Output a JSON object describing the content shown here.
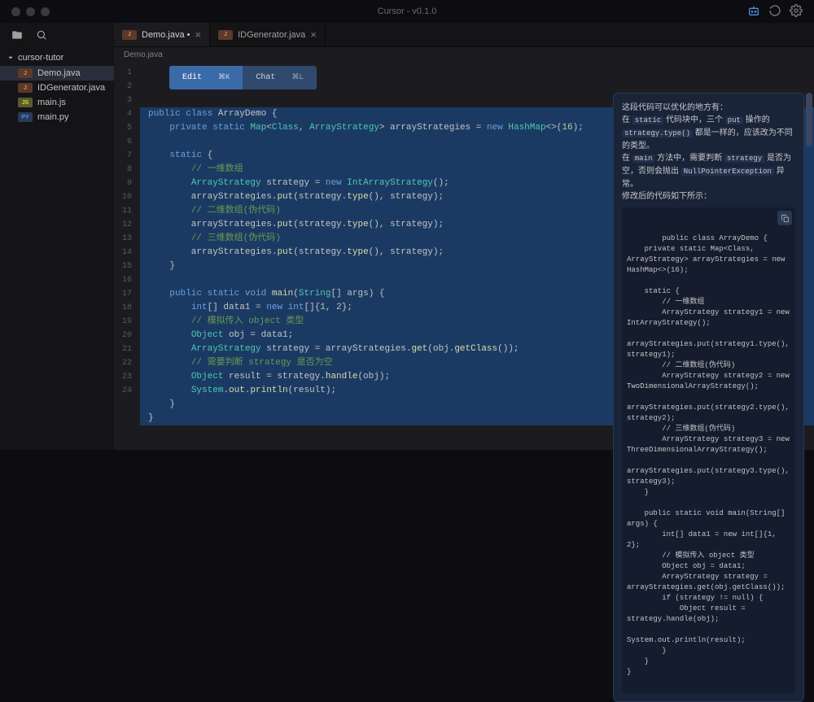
{
  "window": {
    "title": "Cursor - v0.1.0"
  },
  "sidebar": {
    "folder": "cursor-tutor",
    "files": [
      {
        "icon": "J",
        "cls": "ico-j",
        "name": "Demo.java",
        "active": true
      },
      {
        "icon": "J",
        "cls": "ico-j",
        "name": "IDGenerator.java",
        "active": false
      },
      {
        "icon": "JS",
        "cls": "ico-js",
        "name": "main.js",
        "active": false
      },
      {
        "icon": "PY",
        "cls": "ico-py",
        "name": "main.py",
        "active": false
      }
    ]
  },
  "tabs": [
    {
      "icon": "J",
      "label": "Demo.java",
      "dirty": true,
      "active": true
    },
    {
      "icon": "J",
      "label": "IDGenerator.java",
      "dirty": false,
      "active": false
    }
  ],
  "breadcrumb": "Demo.java",
  "popup": {
    "edit": "Edit",
    "edit_kbd": "⌘K",
    "chat": "Chat",
    "chat_kbd": "⌘L"
  },
  "gutter_start": 1,
  "gutter_end": 24,
  "code_lines": [
    "public class ArrayDemo {",
    "    private static Map<Class, ArrayStrategy> arrayStrategies = new HashMap<>(16);",
    "",
    "    static {",
    "        // 一维数组",
    "        ArrayStrategy strategy = new IntArrayStrategy();",
    "        arrayStrategies.put(strategy.type(), strategy);",
    "        // 二维数组(伪代码)",
    "        arrayStrategies.put(strategy.type(), strategy);",
    "        // 三维数组(伪代码)",
    "        arrayStrategies.put(strategy.type(), strategy);",
    "    }",
    "",
    "    public static void main(String[] args) {",
    "        int[] data1 = new int[]{1, 2};",
    "        // 模拟传入 object 类型",
    "        Object obj = data1;",
    "        ArrayStrategy strategy = arrayStrategies.get(obj.getClass());",
    "        // 需要判断 strategy 是否为空",
    "        Object result = strategy.handle(obj);",
    "        System.out.println(result);",
    "    }",
    "}",
    ""
  ],
  "ai": {
    "intro": "这段代码可以优化的地方有：",
    "p1a": "在 ",
    "p1b": " 代码块中，三个 ",
    "p1c": " 操作的 ",
    "p1d": " 都是一样的，应该改为不同的类型。",
    "c_static": "static",
    "c_put": "put",
    "c_type": "strategy.type()",
    "p2a": "在 ",
    "p2b": " 方法中，需要判断 ",
    "p2c": " 是否为空，否则会抛出 ",
    "p2d": " 异常。",
    "c_main": "main",
    "c_strategy": "strategy",
    "c_npe": "NullPointerException",
    "fix_hdr": "修改后的代码如下所示：",
    "code": "public class ArrayDemo {\n    private static Map<Class, ArrayStrategy> arrayStrategies = new HashMap<>(16);\n\n    static {\n        // 一维数组\n        ArrayStrategy strategy1 = new IntArrayStrategy();\n        arrayStrategies.put(strategy1.type(), strategy1);\n        // 二维数组(伪代码)\n        ArrayStrategy strategy2 = new TwoDimensionalArrayStrategy();\n        arrayStrategies.put(strategy2.type(), strategy2);\n        // 三维数组(伪代码)\n        ArrayStrategy strategy3 = new ThreeDimensionalArrayStrategy();\n        arrayStrategies.put(strategy3.type(), strategy3);\n    }\n\n    public static void main(String[] args) {\n        int[] data1 = new int[]{1, 2};\n        // 模拟传入 object 类型\n        Object obj = data1;\n        ArrayStrategy strategy = arrayStrategies.get(obj.getClass());\n        if (strategy != null) {\n            Object result = strategy.handle(obj);\n            System.out.println(result);\n        }\n    }\n}"
  }
}
